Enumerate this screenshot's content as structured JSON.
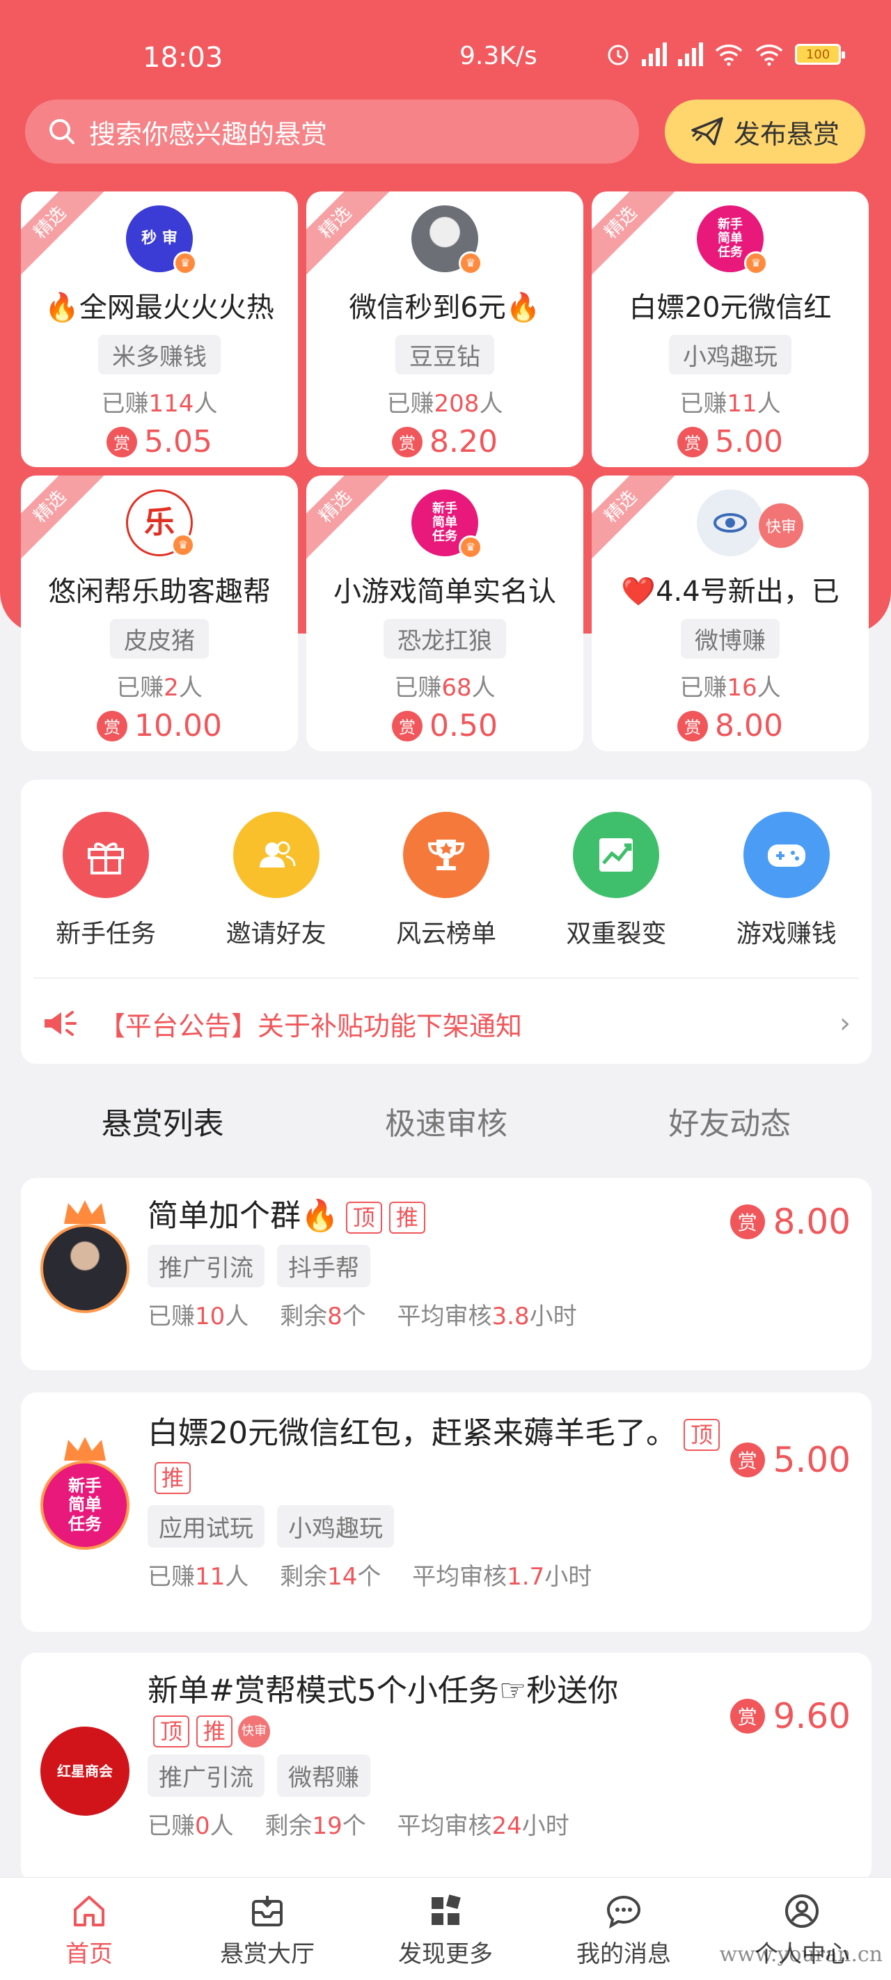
{
  "status_bar": {
    "time": "18:03",
    "net_speed": "9.3K/s",
    "battery": "100"
  },
  "search": {
    "placeholder": "搜索你感兴趣的悬赏",
    "publish_label": "发布悬赏"
  },
  "featured": [
    {
      "ribbon": "精选",
      "avatar_text": "秒 审",
      "avatar_color": "#3b3bd6",
      "title": "🔥全网最火火火热",
      "tag": "米多赚钱",
      "earned_prefix": "已赚",
      "earned": "114",
      "earned_suffix": "人",
      "shang": "赏",
      "reward": "5.05"
    },
    {
      "ribbon": "精选",
      "avatar_text": "",
      "avatar_color": "#9aa0a8",
      "title": "微信秒到6元🔥",
      "tag": "豆豆钻",
      "earned_prefix": "已赚",
      "earned": "208",
      "earned_suffix": "人",
      "shang": "赏",
      "reward": "8.20"
    },
    {
      "ribbon": "精选",
      "avatar_text": "新手 简单 任务",
      "avatar_color": "#e8197a",
      "title": "白嫖20元微信红",
      "tag": "小鸡趣玩",
      "earned_prefix": "已赚",
      "earned": "11",
      "earned_suffix": "人",
      "shang": "赏",
      "reward": "5.00"
    },
    {
      "ribbon": "精选",
      "avatar_text": "乐",
      "avatar_color": "#e03024",
      "title": "悠闲帮乐助客趣帮",
      "tag": "皮皮猪",
      "earned_prefix": "已赚",
      "earned": "2",
      "earned_suffix": "人",
      "shang": "赏",
      "reward": "10.00"
    },
    {
      "ribbon": "精选",
      "avatar_text": "新手 简单 任务",
      "avatar_color": "#e8197a",
      "title": "小游戏简单实名认",
      "tag": "恐龙扛狼",
      "earned_prefix": "已赚",
      "earned": "68",
      "earned_suffix": "人",
      "shang": "赏",
      "reward": "0.50"
    },
    {
      "ribbon": "精选",
      "avatar_text": "",
      "avatar_color": "#e9eef5",
      "title": "❤️4.4号新出，已",
      "tag": "微博赚",
      "earned_prefix": "已赚",
      "earned": "16",
      "earned_suffix": "人",
      "shang": "赏",
      "reward": "8.00",
      "fast": "快审"
    }
  ],
  "shortcuts": [
    {
      "label": "新手任务",
      "color": "#f2545b",
      "icon": "gift-icon"
    },
    {
      "label": "邀请好友",
      "color": "#f9c02b",
      "icon": "friends-icon"
    },
    {
      "label": "风云榜单",
      "color": "#f5793b",
      "icon": "trophy-icon"
    },
    {
      "label": "双重裂变",
      "color": "#3fbf6b",
      "icon": "chart-icon"
    },
    {
      "label": "游戏赚钱",
      "color": "#4a9cf5",
      "icon": "gamepad-icon"
    }
  ],
  "notice": {
    "text": "【平台公告】关于补贴功能下架通知"
  },
  "tabs": [
    "悬赏列表",
    "极速审核",
    "好友动态"
  ],
  "tasks": [
    {
      "title": "简单加个群🔥",
      "top": "顶",
      "push": "推",
      "chips": [
        "推广引流",
        "抖手帮"
      ],
      "earned_label": "已赚",
      "earned": "10",
      "person": "人",
      "remain_label": "剩余",
      "remain": "8",
      "unit": "个",
      "avg_label": "平均审核",
      "avg": "3.8",
      "hours": "小时",
      "shang": "赏",
      "reward": "8.00",
      "avatar_text": "",
      "avatar_color": "#3b3a44"
    },
    {
      "title": "白嫖20元微信红包，赶紧来薅羊毛了。",
      "top": "顶",
      "push": "推",
      "chips": [
        "应用试玩",
        "小鸡趣玩"
      ],
      "earned_label": "已赚",
      "earned": "11",
      "person": "人",
      "remain_label": "剩余",
      "remain": "14",
      "unit": "个",
      "avg_label": "平均审核",
      "avg": "1.7",
      "hours": "小时",
      "shang": "赏",
      "reward": "5.00",
      "avatar_text": "新手 简单 任务",
      "avatar_color": "#e8197a"
    },
    {
      "title": "新单#赏帮模式5个小任务☞秒送你",
      "top": "顶",
      "push": "推",
      "fast": "快审",
      "chips": [
        "推广引流",
        "微帮赚"
      ],
      "earned_label": "已赚",
      "earned": "0",
      "person": "人",
      "remain_label": "剩余",
      "remain": "19",
      "unit": "个",
      "avg_label": "平均审核",
      "avg": "24",
      "hours": "小时",
      "shang": "赏",
      "reward": "9.60",
      "avatar_text": "红星商会",
      "avatar_color": "#d0141a"
    }
  ],
  "bottom_nav": [
    "首页",
    "悬赏大厅",
    "发现更多",
    "我的消息",
    "个人中心"
  ],
  "watermark": "www.youran.cn"
}
